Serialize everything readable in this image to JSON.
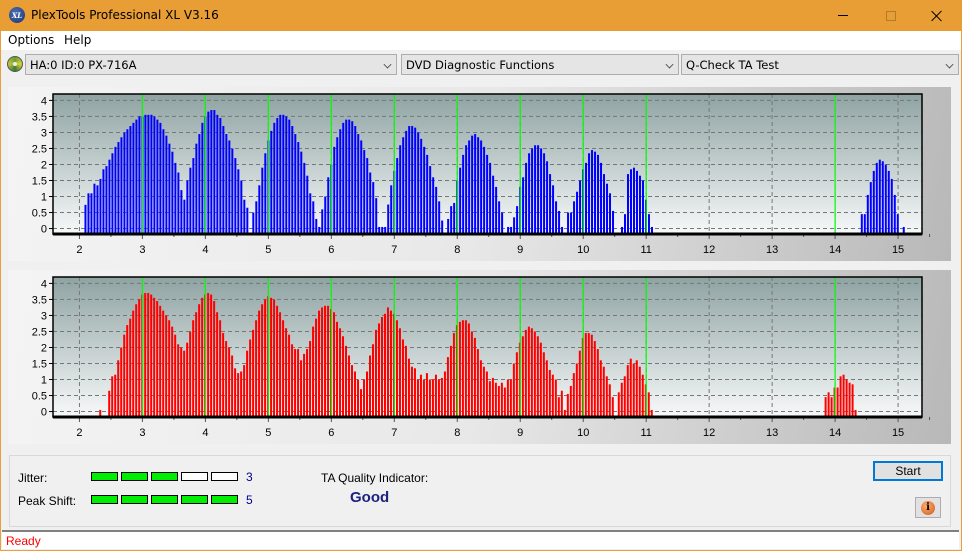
{
  "window": {
    "title": "PlexTools Professional XL V3.16",
    "logo_text": "XL",
    "controls": [
      "minimize",
      "maximize",
      "close"
    ]
  },
  "menu": {
    "items": [
      "Options",
      "Help"
    ]
  },
  "toolbar": {
    "drive": "HA:0 ID:0  PX-716A",
    "function": "DVD Diagnostic Functions",
    "test": "Q-Check TA Test"
  },
  "colors": {
    "titlebar": "#e99d35",
    "land_series": "#0000ff",
    "pit_series": "#ff0000",
    "reference_line": "#00ff00",
    "meter_on": "#00ee00",
    "status_text": "#ff0000",
    "quality_text": "#1a237e"
  },
  "chart_data": [
    {
      "type": "bar",
      "name": "upper-histogram",
      "series_name": "Lands",
      "color": "#0000ff",
      "xlim": [
        1.58,
        15.38
      ],
      "ylim": [
        -0.17,
        4.2
      ],
      "x_ticks": [
        2,
        3,
        4,
        5,
        6,
        7,
        8,
        9,
        10,
        11,
        12,
        13,
        14,
        15
      ],
      "y_ticks": [
        0,
        0.5,
        1,
        1.5,
        2,
        2.5,
        3,
        3.5,
        4
      ],
      "y_tick_labels": [
        "0",
        "0.5",
        "1",
        "1.5",
        "2",
        "2.5",
        "3",
        "3.5",
        "4"
      ],
      "reference_lines_x": [
        3,
        4,
        5,
        6,
        7,
        8,
        9,
        10,
        11,
        14
      ],
      "grid": true,
      "x_start": 1.81,
      "x_step": 0.0476,
      "values": [
        0,
        0,
        0,
        0,
        0,
        0,
        0.74,
        1.1,
        1.1,
        1.4,
        1.35,
        1.55,
        1.85,
        1.95,
        2.15,
        2.35,
        2.55,
        2.7,
        2.85,
        3.0,
        3.1,
        3.2,
        3.3,
        3.4,
        3.5,
        3.5,
        3.55,
        3.55,
        3.55,
        3.5,
        3.4,
        3.3,
        3.1,
        2.9,
        2.65,
        2.4,
        2.05,
        1.75,
        1.2,
        0.9,
        1.5,
        1.9,
        2.2,
        2.65,
        2.95,
        3.3,
        3.5,
        3.65,
        3.7,
        3.7,
        3.55,
        3.45,
        3.2,
        2.95,
        2.75,
        2.5,
        2.2,
        1.85,
        1.5,
        0.9,
        0.65,
        0,
        0.5,
        0.85,
        1.35,
        1.9,
        2.35,
        2.75,
        3.05,
        3.3,
        3.45,
        3.55,
        3.55,
        3.5,
        3.4,
        3.2,
        2.95,
        2.7,
        2.4,
        2.05,
        1.65,
        1.1,
        0.85,
        0.3,
        0.05,
        0.6,
        1.0,
        1.6,
        2.0,
        2.55,
        2.85,
        3.1,
        3.3,
        3.4,
        3.4,
        3.35,
        3.2,
        2.95,
        2.75,
        2.45,
        2.2,
        1.75,
        1.45,
        0.95,
        0.05,
        0.05,
        0.05,
        0.75,
        1.35,
        1.8,
        2.2,
        2.6,
        2.85,
        3.05,
        3.2,
        3.2,
        3.15,
        3.0,
        2.8,
        2.55,
        2.3,
        1.95,
        1.6,
        1.3,
        0.85,
        0.25,
        0,
        0.3,
        0.7,
        0.8,
        1.5,
        1.9,
        2.3,
        2.6,
        2.75,
        2.9,
        2.95,
        2.85,
        2.75,
        2.55,
        2.3,
        2.05,
        1.65,
        1.3,
        0.85,
        0.5,
        0,
        0.05,
        0.05,
        0.35,
        0.7,
        1.3,
        1.6,
        2.05,
        2.35,
        2.5,
        2.6,
        2.6,
        2.5,
        2.35,
        2.1,
        1.7,
        1.35,
        0.85,
        0.55,
        0.05,
        0,
        0.5,
        0.5,
        0.85,
        1.15,
        1.5,
        1.85,
        2.05,
        2.35,
        2.45,
        2.4,
        2.3,
        2.05,
        1.7,
        1.4,
        1.1,
        0.55,
        0,
        0,
        0.05,
        0.45,
        1.7,
        1.85,
        1.9,
        1.8,
        1.65,
        1.5,
        0.9,
        0.45,
        0.05,
        0,
        0,
        0,
        0,
        0,
        0,
        0,
        0,
        0,
        0,
        0,
        0,
        0,
        0,
        0,
        0,
        0,
        0,
        0,
        0,
        0,
        0,
        0,
        0,
        0,
        0,
        0,
        0,
        0,
        0,
        0,
        0,
        0,
        0,
        0,
        0,
        0,
        0,
        0,
        0,
        0,
        0,
        0,
        0,
        0,
        0,
        0,
        0,
        0,
        0,
        0,
        0,
        0,
        0,
        0,
        0,
        0,
        0,
        0,
        0,
        0,
        0,
        0,
        0,
        0,
        0,
        0,
        0,
        0,
        0.45,
        0.45,
        1.05,
        1.45,
        1.8,
        2.05,
        2.15,
        2.1,
        2.0,
        1.8,
        1.55,
        1.05,
        0.45,
        0,
        0.05
      ],
      "xlabel": "",
      "ylabel": ""
    },
    {
      "type": "bar",
      "name": "lower-histogram",
      "series_name": "Pits",
      "color": "#ff0000",
      "xlim": [
        1.58,
        15.38
      ],
      "ylim": [
        -0.17,
        4.2
      ],
      "x_ticks": [
        2,
        3,
        4,
        5,
        6,
        7,
        8,
        9,
        10,
        11,
        12,
        13,
        14,
        15
      ],
      "y_ticks": [
        0,
        0.5,
        1,
        1.5,
        2,
        2.5,
        3,
        3.5,
        4
      ],
      "y_tick_labels": [
        "0",
        "0.5",
        "1",
        "1.5",
        "2",
        "2.5",
        "3",
        "3.5",
        "4"
      ],
      "reference_lines_x": [
        3,
        4,
        5,
        6,
        7,
        8,
        9,
        10,
        11,
        14
      ],
      "grid": true,
      "x_start": 2.33,
      "x_step": 0.0476,
      "values": [
        0.05,
        0,
        0,
        0.65,
        1.1,
        1.15,
        1.6,
        2.0,
        2.4,
        2.7,
        2.9,
        3.15,
        3.35,
        3.5,
        3.65,
        3.7,
        3.7,
        3.65,
        3.55,
        3.45,
        3.3,
        3.15,
        3.0,
        2.85,
        2.65,
        2.4,
        2.1,
        2.0,
        1.9,
        2.15,
        2.5,
        2.85,
        3.1,
        3.35,
        3.55,
        3.65,
        3.7,
        3.65,
        3.45,
        3.1,
        2.85,
        2.45,
        2.2,
        2.0,
        1.75,
        1.35,
        1.2,
        1.25,
        1.45,
        1.9,
        2.25,
        2.55,
        2.85,
        3.15,
        3.35,
        3.5,
        3.6,
        3.55,
        3.5,
        3.3,
        3.1,
        2.85,
        2.6,
        2.4,
        2.1,
        1.95,
        1.95,
        1.6,
        1.8,
        1.95,
        2.2,
        2.65,
        2.9,
        3.15,
        3.25,
        3.3,
        3.3,
        3.2,
        3.1,
        2.8,
        2.6,
        2.35,
        2.05,
        1.75,
        1.45,
        1.25,
        1.0,
        0.7,
        1.0,
        1.25,
        1.75,
        2.1,
        2.55,
        2.75,
        2.95,
        3.05,
        3.25,
        3.15,
        3.05,
        2.85,
        2.6,
        2.25,
        2.05,
        1.65,
        1.4,
        1.35,
        1.0,
        1.15,
        1.0,
        1.2,
        1.0,
        1.0,
        1.15,
        1.0,
        1.05,
        1.25,
        1.7,
        2.05,
        2.45,
        2.7,
        2.8,
        2.85,
        2.85,
        2.75,
        2.5,
        2.3,
        1.95,
        1.6,
        1.4,
        1.25,
        0.95,
        1.05,
        0.9,
        0.8,
        0.9,
        0.75,
        1.0,
        1.0,
        1.5,
        1.85,
        2.15,
        2.35,
        2.55,
        2.65,
        2.6,
        2.5,
        2.35,
        2.15,
        1.85,
        1.6,
        1.3,
        1.15,
        1.0,
        0.45,
        0.65,
        0.05,
        0.55,
        0.8,
        1.2,
        1.5,
        1.9,
        2.3,
        2.45,
        2.45,
        2.4,
        2.2,
        1.95,
        1.6,
        1.4,
        1.1,
        0.85,
        0.45,
        0,
        0.6,
        0.9,
        1.1,
        1.45,
        1.65,
        1.5,
        1.6,
        1.4,
        1.15,
        0.85,
        0.6,
        0.05,
        0,
        0,
        0,
        0,
        0,
        0,
        0,
        0,
        0,
        0,
        0,
        0,
        0,
        0,
        0,
        0,
        0,
        0,
        0,
        0,
        0,
        0,
        0,
        0,
        0,
        0,
        0,
        0,
        0,
        0,
        0,
        0,
        0,
        0,
        0,
        0,
        0,
        0,
        0,
        0,
        0,
        0,
        0,
        0,
        0,
        0,
        0,
        0,
        0,
        0,
        0,
        0,
        0,
        0,
        0,
        0,
        0,
        0.45,
        0.6,
        0.45,
        0.75,
        0.75,
        1.1,
        1.15,
        1.0,
        0.9,
        0.85,
        0.05
      ],
      "xlabel": "",
      "ylabel": ""
    }
  ],
  "results": {
    "jitter_label": "Jitter:",
    "jitter_value": "3",
    "jitter_level": 3,
    "peak_shift_label": "Peak Shift:",
    "peak_shift_value": "5",
    "peak_shift_level": 5,
    "meter_segments": 5,
    "quality_label": "TA Quality Indicator:",
    "quality_value": "Good"
  },
  "buttons": {
    "start": "Start",
    "info_icon": "info-icon"
  },
  "status": {
    "text": "Ready"
  }
}
